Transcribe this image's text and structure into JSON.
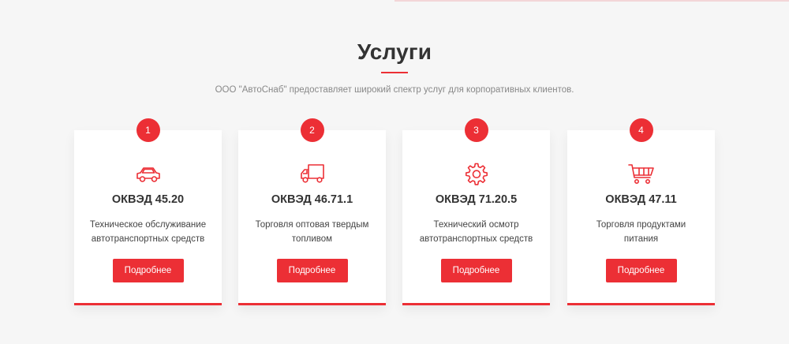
{
  "section": {
    "title": "Услуги",
    "subtitle": "ООО \"АвтоСнаб\" предоставляет широкий спектр услуг для корпоративных клиентов."
  },
  "colors": {
    "accent": "#ec2f35",
    "background": "#f6f6f6",
    "card": "#ffffff",
    "text": "#333333"
  },
  "cards": [
    {
      "number": "1",
      "icon": "car-icon",
      "code": "ОКВЭД 45.20",
      "description": "Техническое обслуживание автотранспортных средств",
      "button_label": "Подробнее"
    },
    {
      "number": "2",
      "icon": "truck-icon",
      "code": "ОКВЭД 46.71.1",
      "description": "Торговля оптовая твердым топливом",
      "button_label": "Подробнее"
    },
    {
      "number": "3",
      "icon": "gear-icon",
      "code": "ОКВЭД 71.20.5",
      "description": "Технический осмотр автотранспортных средств",
      "button_label": "Подробнее"
    },
    {
      "number": "4",
      "icon": "cart-icon",
      "code": "ОКВЭД 47.11",
      "description": "Торговля продуктами питания",
      "button_label": "Подробнее"
    }
  ]
}
